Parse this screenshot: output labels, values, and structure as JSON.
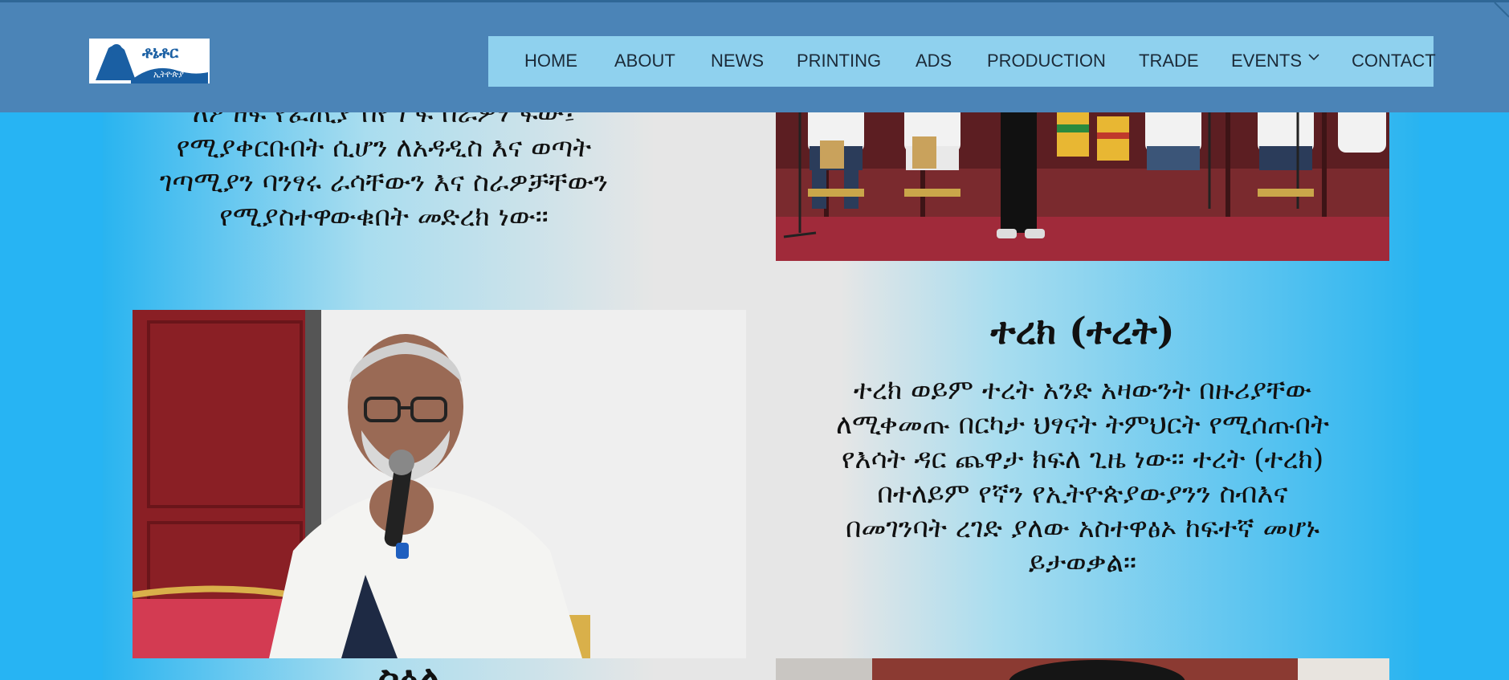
{
  "site": {
    "logo_text_line1": "ቶኔቶር",
    "logo_text_line2": "ኢትዮጵያ"
  },
  "nav": {
    "items": [
      {
        "label": "HOME"
      },
      {
        "label": "ABOUT"
      },
      {
        "label": "NEWS"
      },
      {
        "label": "PRINTING"
      },
      {
        "label": "ADS"
      },
      {
        "label": "PRODUCTION"
      },
      {
        "label": "TRADE"
      },
      {
        "label": "EVENTS",
        "has_dropdown": true
      },
      {
        "label": "CONTACT"
      }
    ],
    "icons": {
      "events_dropdown": "chevron-down-icon"
    }
  },
  "section1": {
    "paragraph_lines": [
      "ለፆ ዘፍ የፈጢያ በየግ ፍ በራዎሃ ፍው፤",
      "የሚያቀርቡበት ሲሆን ለአዳዲስ እና ወጣት",
      "ገጣሚያን ባንፃሩ ራሳቸውን እና ስራዎቻቸውን",
      "የሚያስተዋውቁበት መድረክ ነው፡፡"
    ]
  },
  "section2": {
    "heading": "ተረክ (ተረት)",
    "paragraph_lines": [
      "ተረክ ወይም ተረት አንድ አዛውንት በዙሪያቸው",
      "ለሚቀመጡ በርካታ ህፃናት ትምህርት የሚሰጡበት",
      "የእሳት ዳር ጨዋታ ክፍለ ጊዜ ነው፡፡ ተረት (ተረክ)",
      "በተለይም የኛን የኢትዮጵያውያንን ስብእና",
      "በመገንባት ረገድ ያለው አስተዋፅኦ ከፍተኛ መሆኑ",
      "ይታወቃል፡፡"
    ]
  },
  "section3": {
    "heading_partial": "ስዕል"
  },
  "colors": {
    "page_bg": "#27b4f3",
    "header_bg": "#4b84b7",
    "nav_bg": "#8fd1ee",
    "logo_blue": "#1a5fa3"
  }
}
